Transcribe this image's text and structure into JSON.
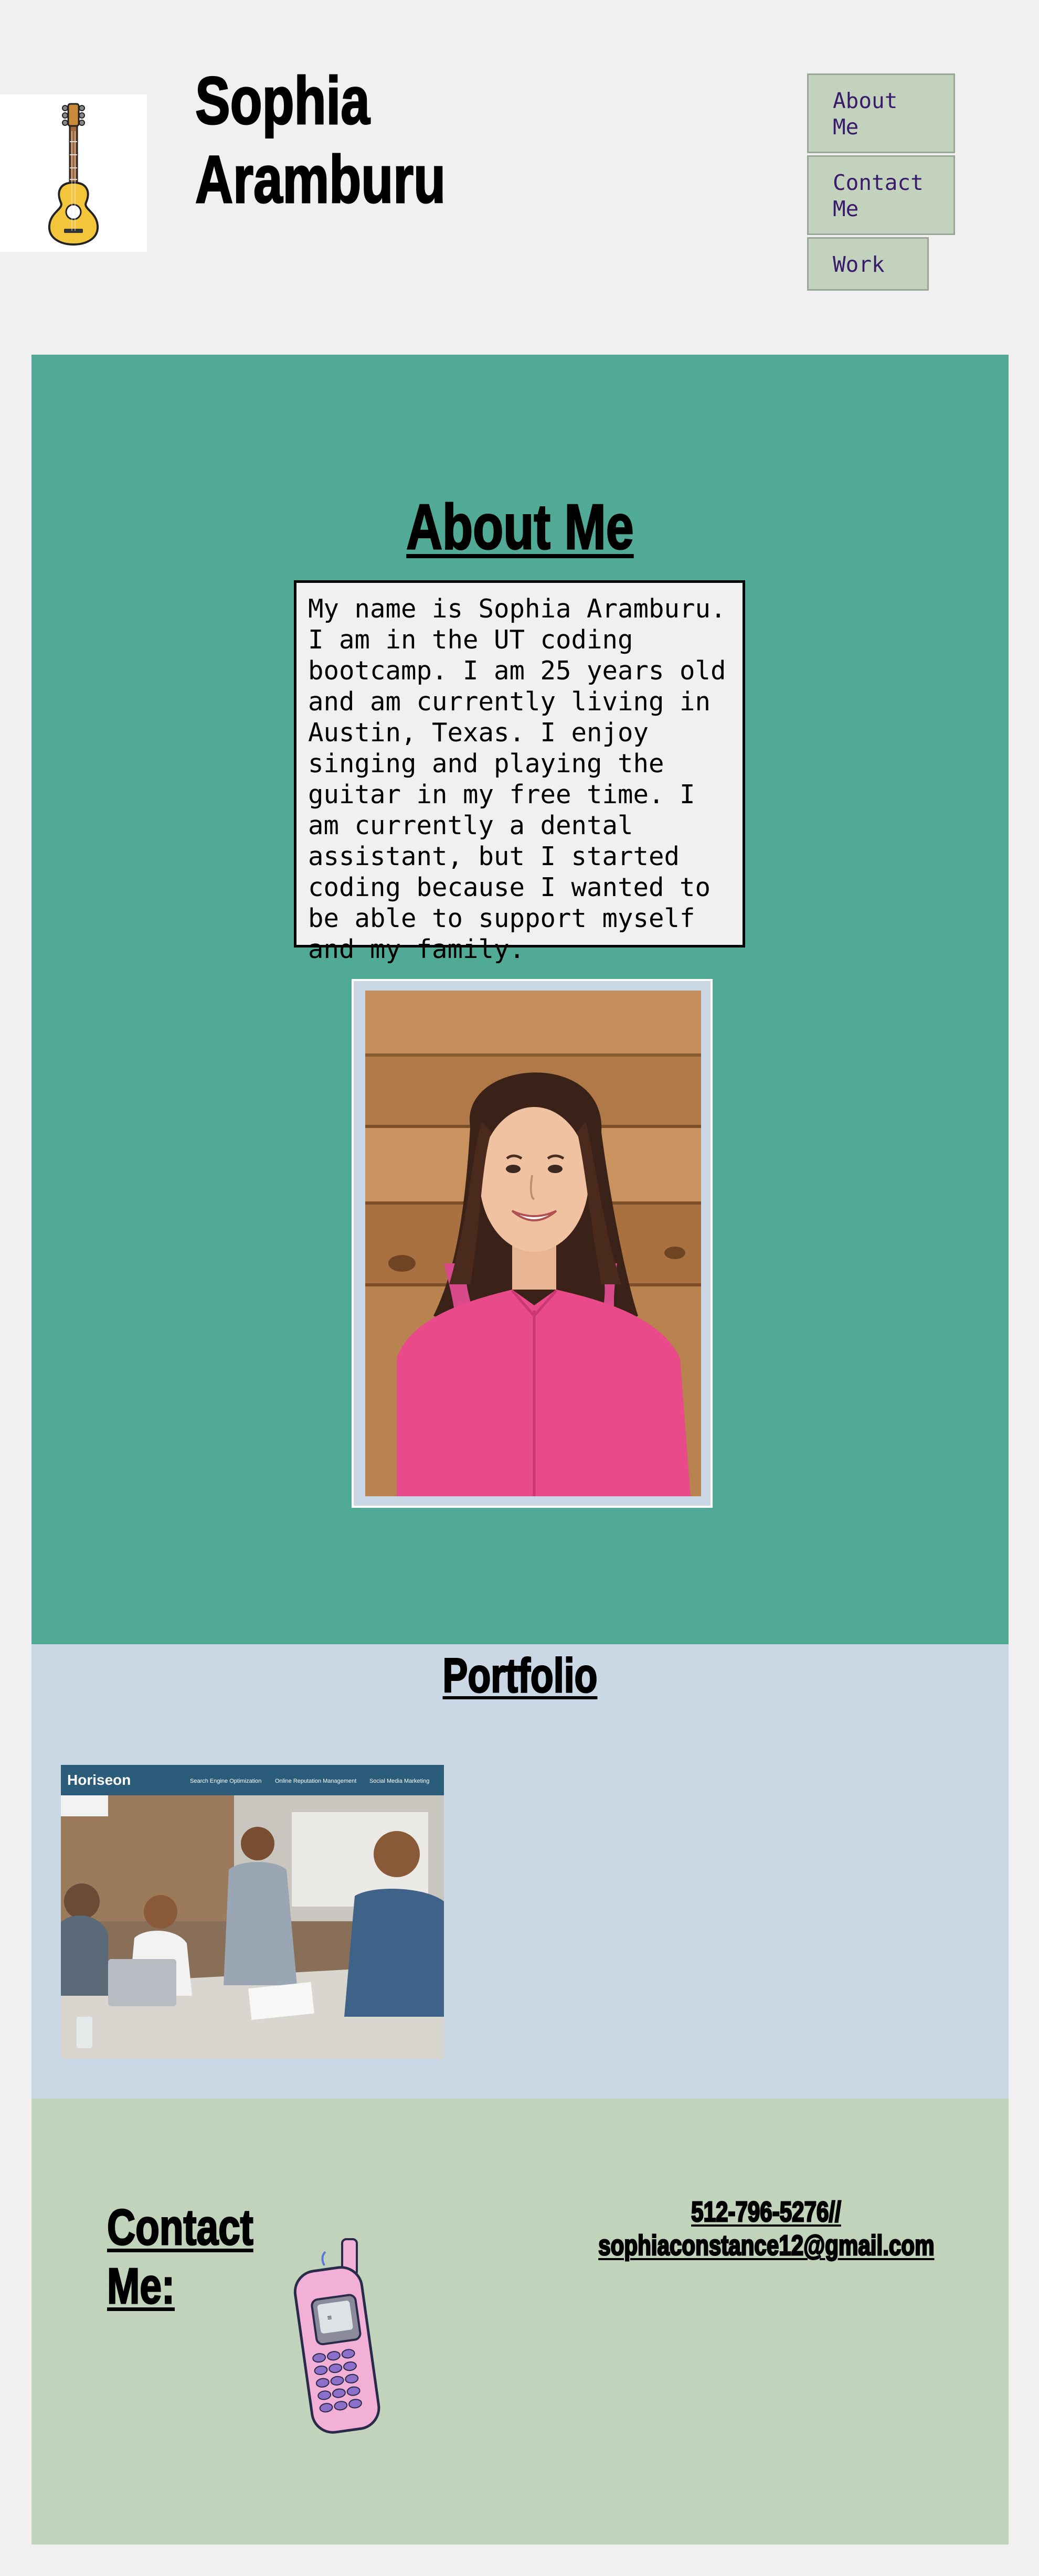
{
  "header": {
    "title": "Sophia Aramburu",
    "logo_icon": "guitar-icon",
    "nav": [
      {
        "label": "About Me"
      },
      {
        "label": "Contact Me"
      },
      {
        "label": "Work"
      }
    ]
  },
  "about": {
    "heading": "About Me",
    "text": "My name is Sophia Aramburu. I am in the UT coding bootcamp. I am 25 years old and am currently living in Austin, Texas. I enjoy singing and playing the guitar in my free time. I am currently a dental assistant, but I started coding because I wanted to be able to support myself and my family.",
    "portrait": "portrait-photo"
  },
  "portfolio": {
    "heading": "Portfolio",
    "project": {
      "brand": "Horiseon",
      "nav": [
        "Search Engine Optimization",
        "Online Reputation Management",
        "Social Media Marketing"
      ]
    }
  },
  "contact": {
    "heading": "Contact Me:",
    "phone": "512-796-5276//",
    "email": "sophiaconstance12@gmail.com",
    "icon": "cell-phone-icon"
  },
  "colors": {
    "page_bg": "#f0f0f0",
    "about_bg": "#51aa96",
    "portfolio_bg": "#c9d8e4",
    "contact_bg": "#c2d3bc",
    "nav_bg": "#c3d2bc",
    "nav_text": "#3a1a6a"
  }
}
